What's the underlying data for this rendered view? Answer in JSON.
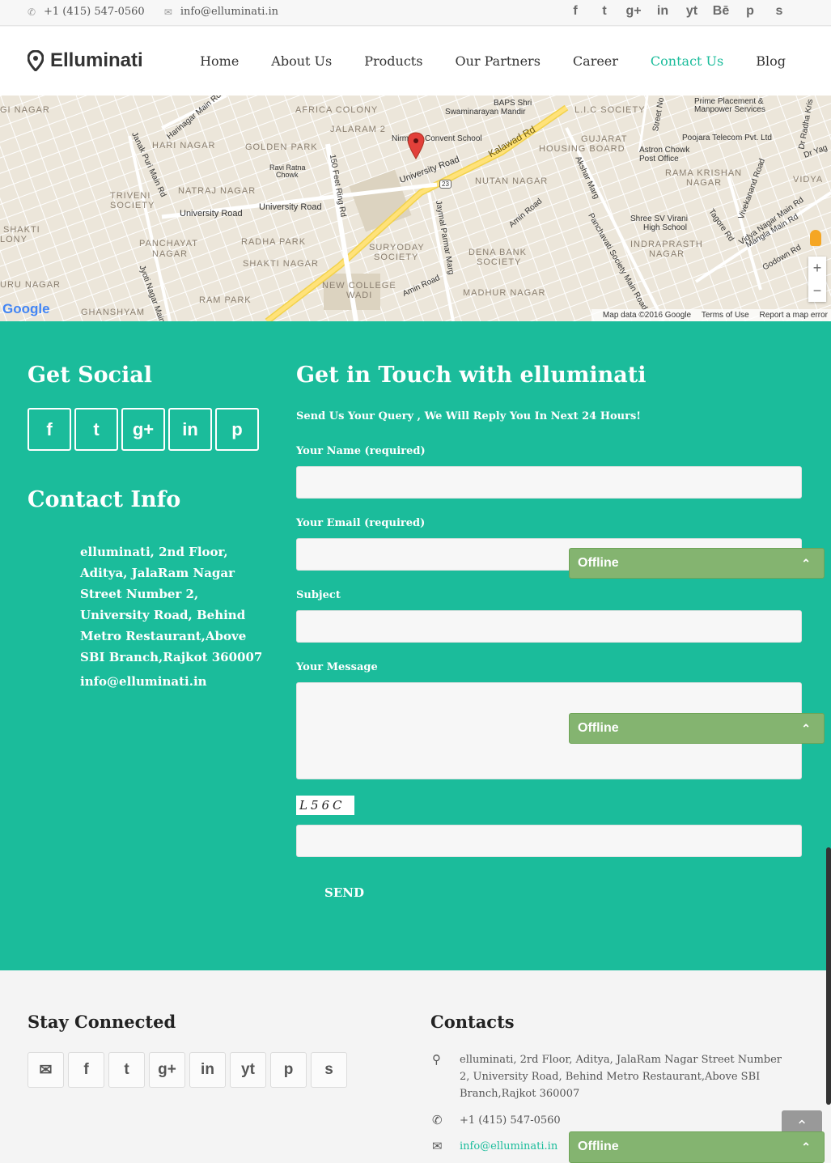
{
  "topbar": {
    "phone": "+1 (415) 547-0560",
    "email": "info@elluminati.in",
    "social": [
      "f",
      "t",
      "g+",
      "in",
      "yt",
      "Bē",
      "p",
      "s"
    ]
  },
  "header": {
    "brand": "Elluminati",
    "nav": [
      {
        "label": "Home"
      },
      {
        "label": "About Us"
      },
      {
        "label": "Products"
      },
      {
        "label": "Our Partners"
      },
      {
        "label": "Career"
      },
      {
        "label": "Contact Us",
        "active": true
      },
      {
        "label": "Blog"
      }
    ]
  },
  "map": {
    "labels": {
      "africa": "AFRICA COLONY",
      "jalaram": "JALARAM 2",
      "bapsA": "BAPS Shri",
      "bapsB": "Swaminarayan Mandir",
      "lic": "L.I.C SOCIETY",
      "prime1": "Prime Placement &",
      "prime2": "Manpower Services",
      "golden": "GOLDEN PARK",
      "hari": "HARI NAGAR",
      "convent": "Convent School",
      "nirm": "Nirm",
      "kalawad": "Kalawad Rd",
      "gujarat": "GUJARAT",
      "housing": "HOUSING BOARD",
      "astron1": "Astron Chowk",
      "astron2": "Post Office",
      "poojara": "Poojara Telecom Pvt. Ltd",
      "ravi1": "Ravi Ratna",
      "ravi2": "Chowk",
      "triveni1": "TRIVENI",
      "triveni2": "SOCIETY",
      "natraj": "NATRAJ NAGAR",
      "univ1": "University Road",
      "univ2": "University Road",
      "univ3": "University Road",
      "nutan": "NUTAN NAGAR",
      "rama1": "RAMA KRISHAN",
      "rama2": "NAGAR",
      "shakti1": "SHAKTI",
      "shakti2": "LONY",
      "panch1": "PANCHAYAT",
      "panch2": "NAGAR",
      "radha": "RADHA PARK",
      "suryo1": "SURYODAY",
      "suryo2": "SOCIETY",
      "shree1": "Shree SV Virani",
      "shree2": "High School",
      "indra1": "INDRAPRASTH",
      "indra2": "NAGAR",
      "shaktinagar": "SHAKTI NAGAR",
      "dena1": "DENA BANK",
      "dena2": "SOCIETY",
      "uru": "URU NAGAR",
      "newcol1": "NEW COLLEGE",
      "newcol2": "WADI",
      "madhur": "MADHUR NAGAR",
      "ram": "RAM PARK",
      "ghansh": "GHANSHYAM",
      "ginagar": "GI NAGAR",
      "vidya": "VIDYA",
      "amin": "Amin Road",
      "amin2": "Amin Road",
      "janak": "Janak Puri Main Rd",
      "feet": "150 Feet Ring Rd",
      "jaymal": "Jaymal Parmar Marg",
      "akshar": "Akshar Marg",
      "panchvati": "Panchavati Society Main Road",
      "vivek": "Vivekanand Road",
      "tagore": "Tagore Rd",
      "vidyanagar": "Vidya Nagar Main Rd",
      "mangla": "Mangla Main Rd",
      "godown": "Godown Rd",
      "hari_main": "Harinagar Main Rd",
      "jyoti": "Jyoti Nagar Main",
      "street": "Street No",
      "radhakris": "Dr Radha Kris",
      "dryag": "Dr Yag",
      "shield": "23"
    },
    "google": "Google",
    "footer": [
      "Map data ©2016 Google",
      "Terms of Use",
      "Report a map error"
    ],
    "zoom_in": "+",
    "zoom_out": "−"
  },
  "social_section": {
    "title": "Get Social",
    "icons": [
      "f",
      "t",
      "g+",
      "in",
      "p"
    ]
  },
  "contact_info": {
    "title": "Contact Info",
    "address": "elluminati, 2nd Floor, Aditya, JalaRam Nagar Street Number 2, University Road, Behind Metro Restaurant,Above SBI Branch,Rajkot 360007",
    "email": "info@elluminati.in"
  },
  "form": {
    "title": "Get in Touch with elluminati",
    "subtitle": "Send Us Your Query , We Will Reply You In Next 24 Hours!",
    "name_label": "Your Name (required)",
    "email_label": "Your Email (required)",
    "subject_label": "Subject",
    "message_label": "Your Message",
    "captcha": "L56C",
    "send": "SEND"
  },
  "chat_widget": {
    "status": "Offline",
    "chevron": "⌃"
  },
  "footer": {
    "stay_title": "Stay Connected",
    "stay_icons": [
      "✉",
      "f",
      "t",
      "g+",
      "in",
      "yt",
      "p",
      "s"
    ],
    "contacts_title": "Contacts",
    "address": "elluminati, 2rd Floor, Aditya, JalaRam Nagar Street Number 2, University Road, Behind Metro Restaurant,Above SBI Branch,Rajkot 360007",
    "phone": "+1 (415) 547-0560",
    "email": "info@elluminati.in",
    "to_top": "⌃"
  }
}
